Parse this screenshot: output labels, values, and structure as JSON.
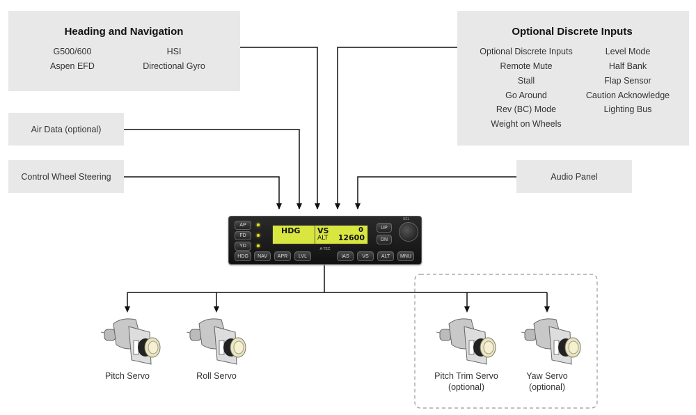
{
  "heading_nav": {
    "title": "Heading and Navigation",
    "items": [
      "G500/600",
      "Aspen EFD",
      "HSI",
      "Directional Gyro"
    ]
  },
  "optional_inputs": {
    "title": "Optional Discrete Inputs",
    "left": [
      "Optional Discrete Inputs",
      "Remote Mute",
      "Stall",
      "Go Around",
      "Rev (BC) Mode",
      "Weight on Wheels"
    ],
    "right": [
      "Level Mode",
      "Half Bank",
      "Flap Sensor",
      "Caution Acknowledge",
      "Lighting Bus"
    ]
  },
  "air_data": "Air Data (optional)",
  "cws": "Control Wheel Steering",
  "audio_panel": "Audio Panel",
  "autopilot": {
    "left_buttons": [
      "AP",
      "FD",
      "YD"
    ],
    "bottom_buttons": [
      "HDG",
      "NAV",
      "APR",
      "LVL",
      "IAS",
      "VS",
      "ALT",
      "MNU"
    ],
    "right_buttons": [
      "UP",
      "DN"
    ],
    "knob_label": "SEL",
    "brand": "A-TEC",
    "display": {
      "mode": "HDG",
      "vs_label": "VS",
      "vs_value": "0",
      "alt_label": "ALT",
      "alt_value": "12600"
    },
    "display_color": "#d9e640"
  },
  "servos": [
    {
      "name": "Pitch Servo"
    },
    {
      "name": "Roll Servo"
    },
    {
      "name": "Pitch Trim Servo",
      "note": "(optional)"
    },
    {
      "name": "Yaw Servo",
      "note": "(optional)"
    }
  ]
}
